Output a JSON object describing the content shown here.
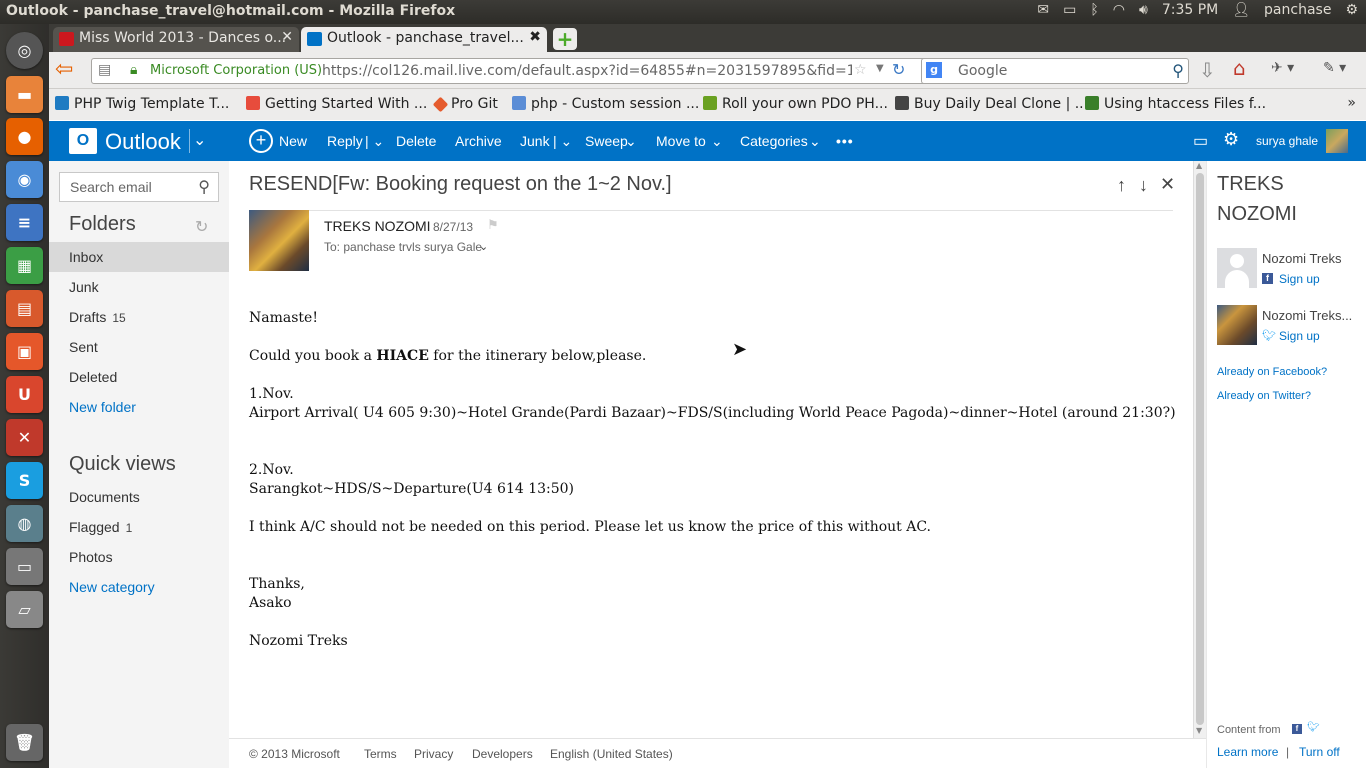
{
  "os": {
    "window_title": "Outlook - panchase_travel@hotmail.com - Mozilla Firefox",
    "clock": "7:35 PM",
    "user": "panchase"
  },
  "browser": {
    "tabs": [
      {
        "label": "Miss World 2013 - Dances o...",
        "close": "✕"
      },
      {
        "label": "Outlook - panchase_travel...",
        "close": "✖"
      }
    ],
    "new_tab": "+",
    "url": "https://col126.mail.live.com/default.aspx?id=64855#n=2031597895&fid=1&mi",
    "identity": "Microsoft Corporation (US)",
    "search_placeholder": "Google",
    "bookmarks": [
      "PHP Twig Template T...",
      "Getting Started With ...",
      "Pro Git",
      "php - Custom session ...",
      "Roll your own PDO PH...",
      "Buy Daily Deal Clone | ...",
      "Using htaccess Files f..."
    ]
  },
  "outlook": {
    "brand": "Outlook",
    "commands": {
      "new": "New",
      "reply": "Reply",
      "delete": "Delete",
      "archive": "Archive",
      "junk": "Junk",
      "sweep": "Sweep",
      "move_to": "Move to",
      "categories": "Categories",
      "more": "•••"
    },
    "user_name": "surya ghale",
    "search_placeholder": "Search email",
    "folders_heading": "Folders",
    "folders": [
      {
        "name": "Inbox",
        "count": ""
      },
      {
        "name": "Junk",
        "count": ""
      },
      {
        "name": "Drafts",
        "count": "15"
      },
      {
        "name": "Sent",
        "count": ""
      },
      {
        "name": "Deleted",
        "count": ""
      }
    ],
    "new_folder": "New folder",
    "quick_views_heading": "Quick views",
    "quick_views": [
      {
        "name": "Documents",
        "count": ""
      },
      {
        "name": "Flagged",
        "count": "1"
      },
      {
        "name": "Photos",
        "count": ""
      }
    ],
    "new_category": "New category"
  },
  "message": {
    "subject": "RESEND[Fw: Booking request on the 1~2 Nov.]",
    "sender": "TREKS NOZOMI",
    "date": "8/27/13",
    "to": "To: panchase trvls surya Gale",
    "body": {
      "greeting": "Namaste!",
      "request_prefix": "Could you book a ",
      "request_bold": "HIACE",
      "request_suffix": " for the itinerary below,please.",
      "day1_label": "1.Nov.",
      "day1_text": "Airport Arrival( U4 605 9:30)~Hotel Grande(Pardi Bazaar)~FDS/S(including World Peace Pagoda)~dinner~Hotel (around 21:30?)",
      "day2_label": "2.Nov.",
      "day2_text": "Sarangkot~HDS/S~Departure(U4 614 13:50)",
      "ac_note": "I think A/C should not be needed on this period. Please let us know the price of this without AC.",
      "thanks": "Thanks,",
      "signer": "Asako",
      "org": "Nozomi Treks"
    }
  },
  "people_pane": {
    "title_line1": "TREKS",
    "title_line2": "NOZOMI",
    "contacts": [
      {
        "name": "Nozomi Treks",
        "action": "Sign up"
      },
      {
        "name": "Nozomi Treks...",
        "action": "Sign up"
      }
    ],
    "already_facebook": "Already on Facebook?",
    "already_twitter": "Already on Twitter?",
    "content_from": "Content from",
    "learn_more": "Learn more",
    "separator": "|",
    "turn_off": "Turn off"
  },
  "footer": {
    "copyright": "© 2013 Microsoft",
    "terms": "Terms",
    "privacy": "Privacy",
    "developers": "Developers",
    "language": "English (United States)"
  }
}
